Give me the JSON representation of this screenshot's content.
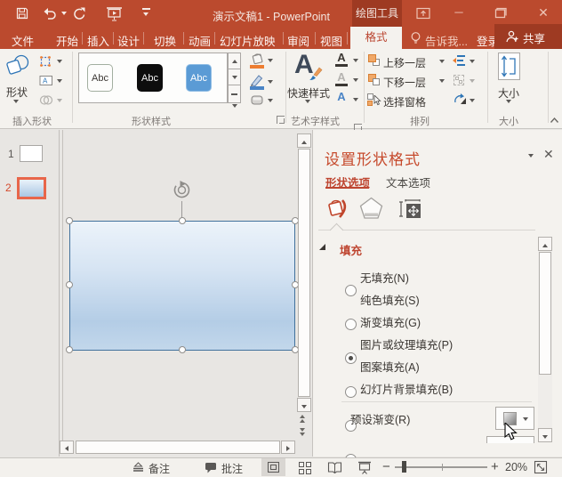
{
  "colors": {
    "titlebar_red": "#BB4A2E",
    "contextual_dark_red": "#9E3A22",
    "accent_red": "#C0452B",
    "accent_blue": "#5B9BD5",
    "slide_selection_orange": "#E8664A"
  },
  "titlebar": {
    "title": "演示文稿1 - PowerPoint",
    "contextual_tab": "绘图工具",
    "qat_icons": [
      "save-icon",
      "undo-icon",
      "redo-icon",
      "start-slideshow-icon",
      "customize-qat-icon"
    ],
    "window_icons": [
      "ribbon-display-options-icon",
      "minimize-icon",
      "maximize-icon",
      "close-icon"
    ]
  },
  "menubar": {
    "tabs": [
      "文件",
      "开始",
      "插入",
      "设计",
      "切换",
      "动画",
      "幻灯片放映",
      "审阅",
      "视图"
    ],
    "active_tab": "格式",
    "tellme": "告诉我...",
    "signin": "登录",
    "share": "共享"
  },
  "ribbon": {
    "insert_shapes": {
      "group_label": "插入形状",
      "shapes_button": "形状"
    },
    "shape_styles": {
      "group_label": "形状样式",
      "gallery": [
        "Abc",
        "Abc",
        "Abc"
      ]
    },
    "wordart": {
      "group_label": "艺术字样式",
      "quick_styles": "快速样式"
    },
    "arrange": {
      "group_label": "排列",
      "bring_forward": "上移一层",
      "send_backward": "下移一层",
      "selection_pane": "选择窗格"
    },
    "size": {
      "group_label": "大小",
      "size_button": "大小"
    }
  },
  "slide_panel": {
    "slides": [
      {
        "number": "1"
      },
      {
        "number": "2"
      }
    ]
  },
  "format_pane": {
    "title": "设置形状格式",
    "tabs": {
      "shape": "形状选项",
      "text": "文本选项"
    },
    "tool_icons": [
      "fill-line-icon",
      "effects-pentagon-icon",
      "size-properties-icon"
    ],
    "fill_section": {
      "header": "填充",
      "options": [
        {
          "label": "无填充(N)",
          "selected": false
        },
        {
          "label": "纯色填充(S)",
          "selected": false
        },
        {
          "label": "渐变填充(G)",
          "selected": true
        },
        {
          "label": "图片或纹理填充(P)",
          "selected": false
        },
        {
          "label": "图案填充(A)",
          "selected": false
        },
        {
          "label": "幻灯片背景填充(B)",
          "selected": false
        }
      ],
      "preset_label": "预设渐变(R)"
    }
  },
  "statusbar": {
    "notes": "备注",
    "comments": "批注",
    "view_icons": [
      "normal-view-icon",
      "slide-sorter-icon",
      "reading-view-icon",
      "slideshow-icon",
      "fit-to-window-icon"
    ],
    "zoom_level": "20%"
  }
}
